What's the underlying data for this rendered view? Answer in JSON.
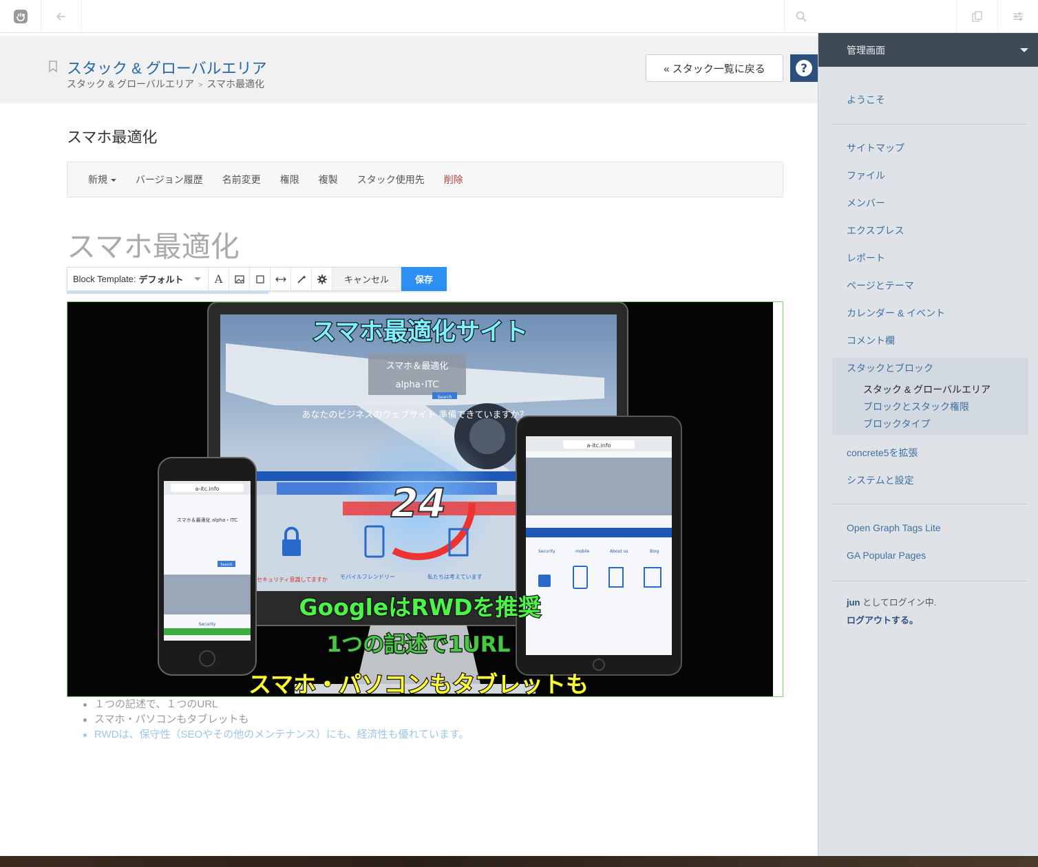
{
  "topbar": {
    "icons": [
      "concrete5-logo-icon",
      "back-arrow-icon",
      "search-icon",
      "pages-icon",
      "settings-sliders-icon"
    ]
  },
  "header": {
    "title": "スタック & グローバルエリア",
    "breadcrumb": [
      "スタック & グローバルエリア",
      "スマホ最適化"
    ],
    "back_button": "« スタック一覧に戻る",
    "help_label": "?"
  },
  "main": {
    "section_title": "スマホ最適化",
    "menu": [
      {
        "label": "新規"
      },
      {
        "label": "バージョン履歴"
      },
      {
        "label": "名前変更"
      },
      {
        "label": "権限"
      },
      {
        "label": "複製"
      },
      {
        "label": "スタック使用先"
      },
      {
        "label": "削除"
      }
    ],
    "big_title": "スマホ最適化"
  },
  "edit_toolbar": {
    "template_label": "Block Template:",
    "template_value": "デフォルト",
    "cancel": "キャンセル",
    "save": "保存"
  },
  "image": {
    "caption_top": "スマホ最適化サイト",
    "caption_google": "GoogleはRWDを推奨",
    "caption_url": "1つの記述で1URL",
    "caption_bottom": "スマホ・パソコンもタブレットも",
    "monitor_site_title": "スマホ＆最適化",
    "monitor_site_sub": "alpha･ITC",
    "monitor_tagline": "あなたのビジネスのウェブサイト 準備できていますか？",
    "counter": "24",
    "monitor_labels": [
      "セキュリティ意識してますか",
      "モバイルフレンドリー",
      "私たちは考えています"
    ],
    "phone_url": "a-itc.info",
    "phone_title": "スマホ＆最適化 alpha・ITC",
    "phone_security": "Security",
    "tablet_url": "a-itc.info",
    "tablet_cols": [
      "Security",
      "mobile",
      "About us",
      "Blog"
    ],
    "search_label": "Search",
    "colors": {
      "cyan": "#7df1ff",
      "green": "#4df24a",
      "yellow": "#ffff33"
    }
  },
  "bullets": [
    "１つの記述で、１つのURL",
    "スマホ・パソコンもタブレットも",
    "RWDは、保守性（SEOやその他のメンテナンス）にも、経済性も優れています。"
  ],
  "sidebar": {
    "title": "管理画面",
    "items": [
      "ようこそ",
      "サイトマップ",
      "ファイル",
      "メンバー",
      "エクスプレス",
      "レポート",
      "ページとテーマ",
      "カレンダー & イベント",
      "コメント欄",
      "スタックとブロック",
      "concrete5を拡張",
      "システムと設定",
      "Open Graph Tags Lite",
      "GA Popular Pages"
    ],
    "sub_items": [
      "スタック & グローバルエリア",
      "ブロックとスタック権限",
      "ブロックタイプ"
    ],
    "login_user": "jun",
    "login_suffix": " としてログイン中.",
    "logout": "ログアウトする。"
  }
}
